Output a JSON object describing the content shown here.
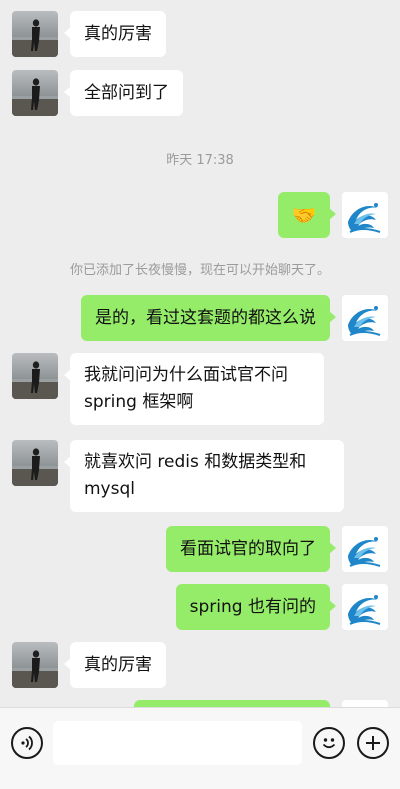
{
  "messages": [
    {
      "side": "left",
      "text": "真的厉害"
    },
    {
      "side": "left",
      "text": "全部问到了"
    },
    {
      "side": "right",
      "emoji": "🤝"
    },
    {
      "side": "right",
      "text": "是的，看过这套题的都这么说"
    },
    {
      "side": "left",
      "text_line1": "我就问问为什么面试官不问",
      "text_line2": "spring 框架啊"
    },
    {
      "side": "left",
      "text_line1": "就喜欢问 redis 和数据类型和",
      "text_line2": "mysql"
    },
    {
      "side": "right",
      "text": "看面试官的取向了"
    },
    {
      "side": "right",
      "text": "spring 也有问的"
    },
    {
      "side": "left",
      "text": "真的厉害"
    }
  ],
  "timestamp": "昨天 17:38",
  "system_notice": "你已添加了长夜慢慢，现在可以开始聊天了。",
  "bottom_bar": {
    "voice_icon": "voice-icon",
    "emoji_icon": "emoji-icon",
    "add_icon": "plus-icon",
    "input_placeholder": ""
  },
  "colors": {
    "background": "#ededed",
    "self_bubble": "#95ec69",
    "other_bubble": "#ffffff"
  }
}
